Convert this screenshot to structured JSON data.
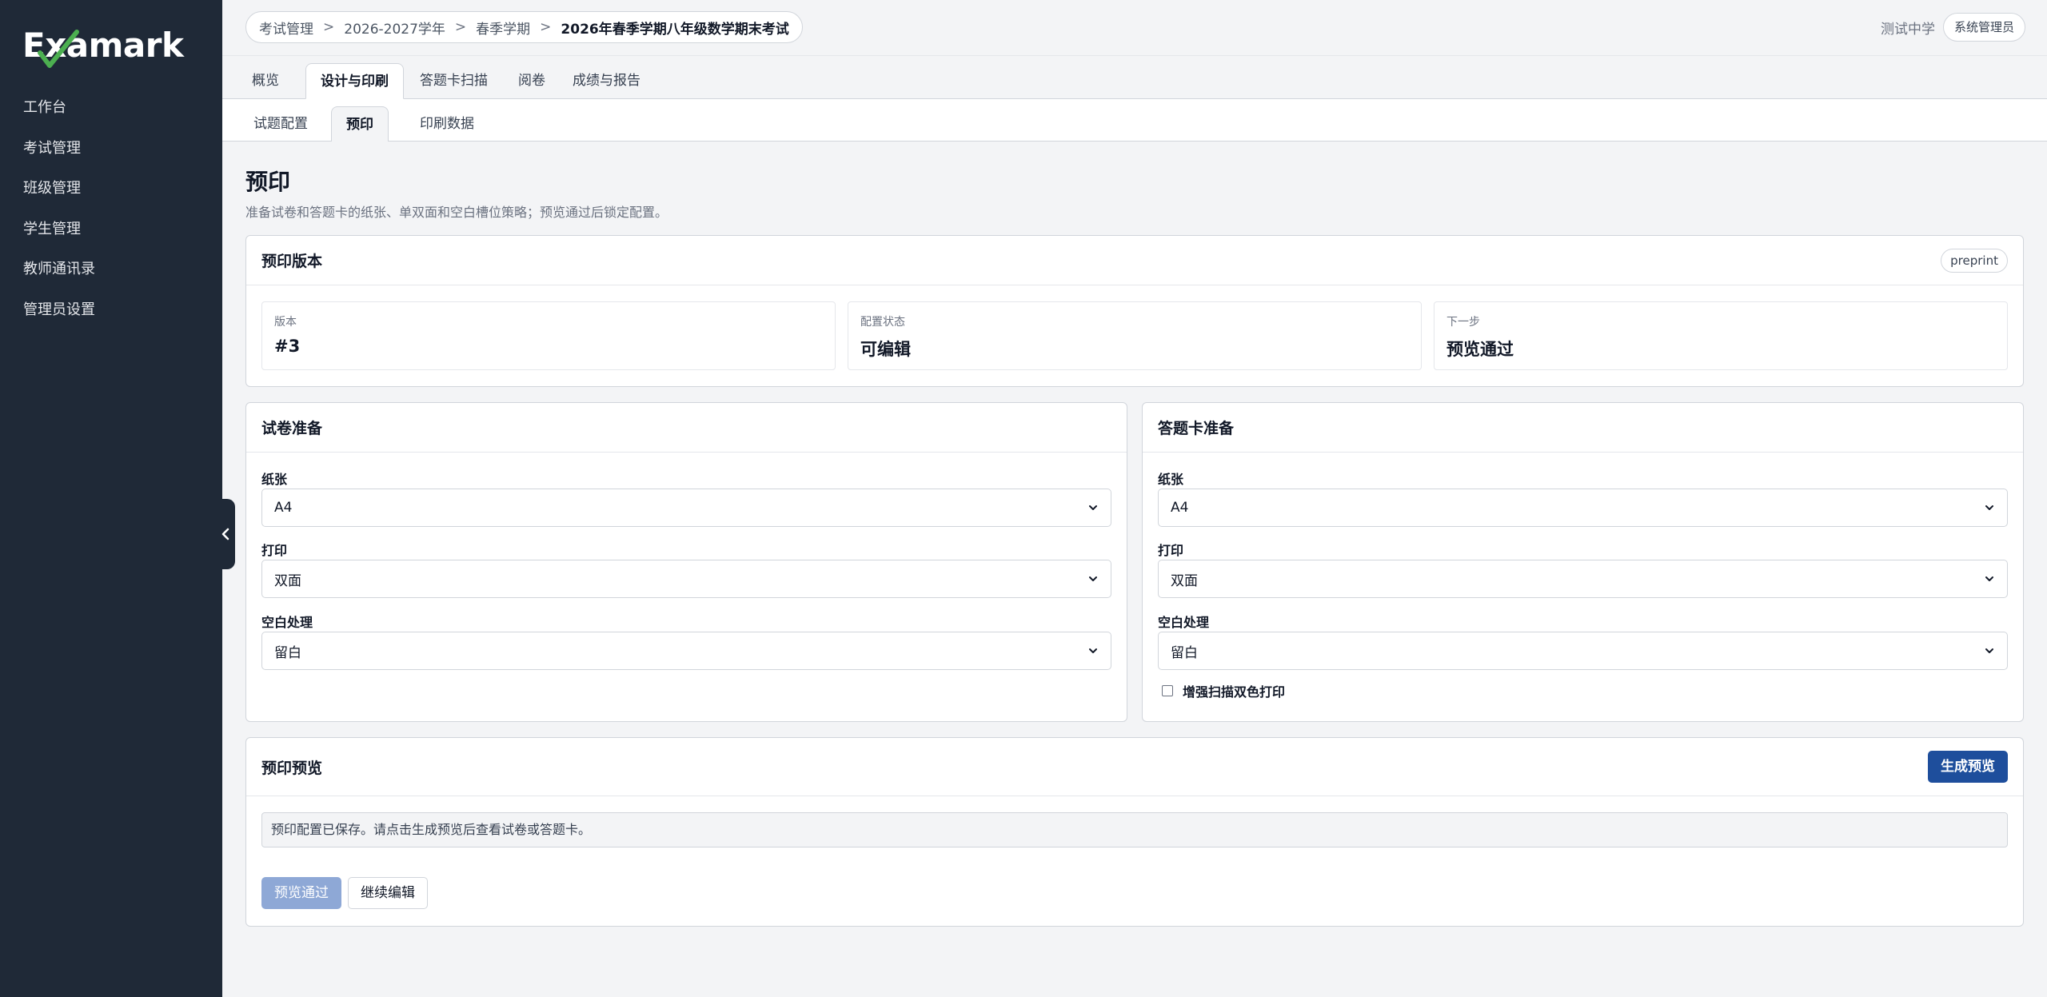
{
  "brand": {
    "logo_text": "Examark"
  },
  "sidebar": {
    "items": [
      {
        "label": "工作台"
      },
      {
        "label": "考试管理"
      },
      {
        "label": "班级管理"
      },
      {
        "label": "学生管理"
      },
      {
        "label": "教师通讯录"
      },
      {
        "label": "管理员设置"
      }
    ]
  },
  "breadcrumb": [
    "考试管理",
    "2026-2027学年",
    "春季学期",
    "2026年春季学期八年级数学期末考试"
  ],
  "breadcrumb_separator": ">",
  "user": {
    "school": "测试中学",
    "role": "系统管理员"
  },
  "tabs": [
    {
      "label": "概览"
    },
    {
      "label": "设计与印刷"
    },
    {
      "label": "答题卡扫描"
    },
    {
      "label": "阅卷"
    },
    {
      "label": "成绩与报告"
    }
  ],
  "subtabs": [
    {
      "label": "试题配置"
    },
    {
      "label": "预印"
    },
    {
      "label": "印刷数据"
    }
  ],
  "page": {
    "title": "预印",
    "description": "准备试卷和答题卡的纸张、单双面和空白槽位策略；预览通过后锁定配置。"
  },
  "version_card": {
    "title": "预印版本",
    "tag": "preprint",
    "stats": [
      {
        "label": "版本",
        "value": "#3"
      },
      {
        "label": "配置状态",
        "value": "可编辑"
      },
      {
        "label": "下一步",
        "value": "预览通过"
      }
    ]
  },
  "paper_card": {
    "title": "试卷准备",
    "paper_label": "纸张",
    "paper_value": "A4",
    "print_label": "打印",
    "print_value": "双面",
    "blank_label": "空白处理",
    "blank_value": "留白"
  },
  "sheet_card": {
    "title": "答题卡准备",
    "paper_label": "纸张",
    "paper_value": "A4",
    "print_label": "打印",
    "print_value": "双面",
    "blank_label": "空白处理",
    "blank_value": "留白",
    "checkbox_label": "增强扫描双色打印",
    "checkbox_checked": false
  },
  "preview_card": {
    "title": "预印预览",
    "generate_label": "生成预览",
    "notice": "预印配置已保存。请点击生成预览后查看试卷或答题卡。",
    "approve_label": "预览通过",
    "continue_label": "继续编辑"
  },
  "colors": {
    "sidebar": "#1f2937",
    "primary": "#1e4e9c",
    "disabled": "#8ea8d6",
    "check": "#4caf50"
  },
  "icons": {
    "collapse": "chevron-left-icon",
    "select": "chevron-down-icon"
  }
}
